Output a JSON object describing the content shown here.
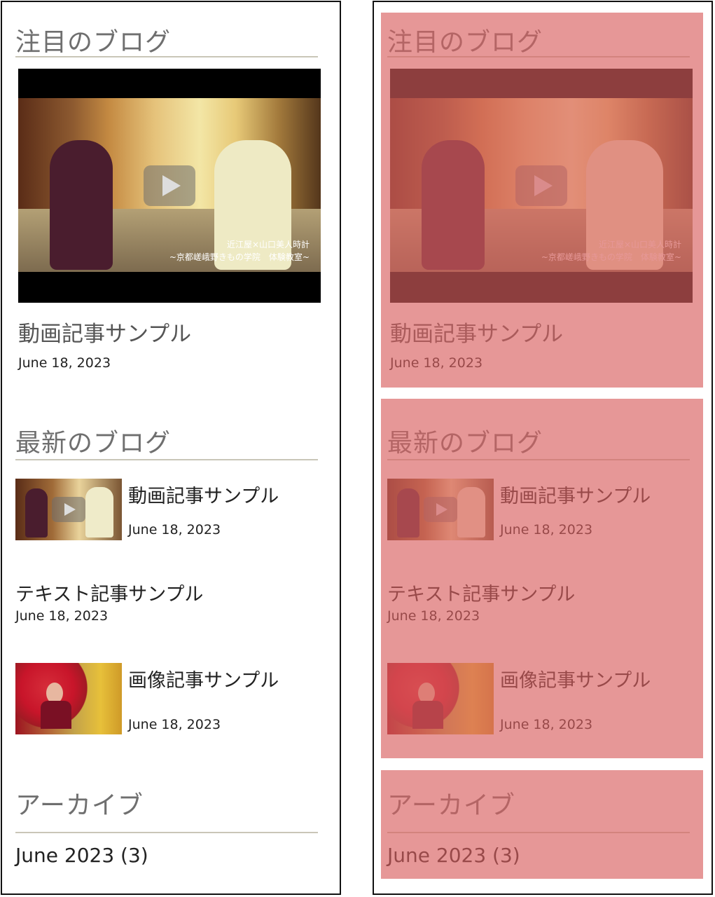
{
  "featured": {
    "heading": "注目のブログ",
    "video_caption_line1": "近江屋×山口美人時計",
    "video_caption_line2": "~京都嵯峨野きもの学院　体験教室~",
    "post_title": "動画記事サンプル",
    "post_date": "June 18, 2023"
  },
  "recent": {
    "heading": "最新のブログ",
    "posts": [
      {
        "title": "動画記事サンプル",
        "date": "June 18, 2023",
        "thumb": "video-thumbnail"
      },
      {
        "title": "テキスト記事サンプル",
        "date": "June 18, 2023"
      },
      {
        "title": "画像記事サンプル",
        "date": "June 18, 2023",
        "thumb": "image-thumbnail"
      }
    ]
  },
  "archive": {
    "heading": "アーカイブ",
    "items": [
      {
        "label": "June 2023 (3)"
      }
    ]
  },
  "colors": {
    "heading": "#6f6f6f",
    "rule": "#c9c6b8",
    "overlay": "#d95f5f"
  }
}
